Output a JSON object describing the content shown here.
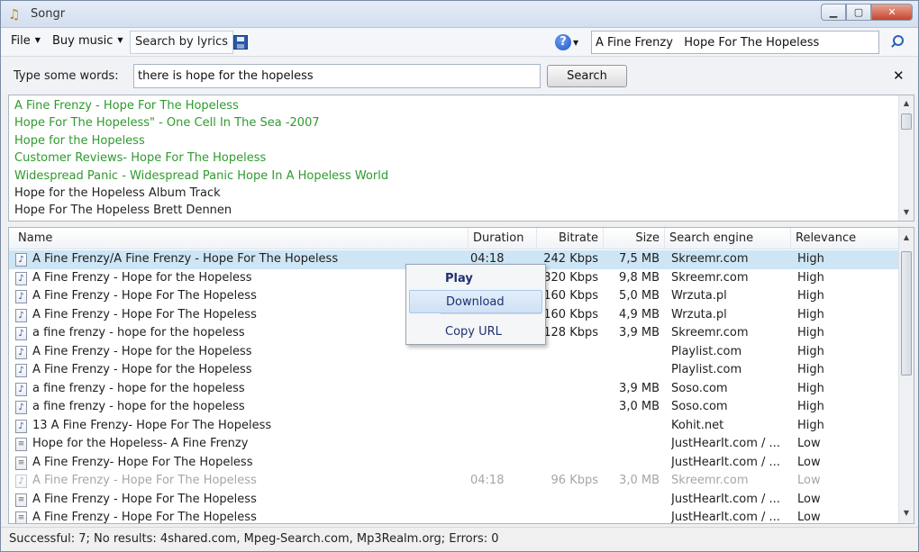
{
  "window": {
    "title": "Songr",
    "minimize": "▁",
    "maximize": "▢",
    "close": "✕"
  },
  "toolbar": {
    "file_menu": "File",
    "buy_music_menu": "Buy music",
    "search_lyrics_button": "Search by lyrics",
    "help_icon": "?",
    "search_value": "A Fine Frenzy   Hope For The Hopeless"
  },
  "lyrics_search": {
    "label": "Type some words:",
    "value": "there is hope for the hopeless",
    "button": "Search",
    "close": "✕"
  },
  "lyrics_results": [
    {
      "text": "A Fine Frenzy  - Hope For The Hopeless",
      "color": "green"
    },
    {
      "text": "Hope For The Hopeless\"  - One Cell In The Sea -2007",
      "color": "green"
    },
    {
      "text": "Hope for the Hopeless",
      "color": "green"
    },
    {
      "text": "Customer Reviews- Hope For The Hopeless",
      "color": "green"
    },
    {
      "text": "Widespread Panic  - Widespread Panic Hope In A Hopeless World",
      "color": "green"
    },
    {
      "text": "Hope for the Hopeless    Album Track",
      "color": "dark"
    },
    {
      "text": "Hope For The Hopeless  Brett Dennen",
      "color": "dark"
    }
  ],
  "columns": {
    "name": "Name",
    "duration": "Duration",
    "bitrate": "Bitrate",
    "size": "Size",
    "engine": "Search engine",
    "relevance": "Relevance"
  },
  "rows": [
    {
      "icon": "audio",
      "name": "A Fine Frenzy/A Fine Frenzy - Hope For The Hopeless",
      "duration": "04:18",
      "bitrate": "242 Kbps",
      "size": "7,5 MB",
      "engine": "Skreemr.com",
      "relevance": "High",
      "selected": true
    },
    {
      "icon": "audio",
      "name": "A Fine Frenzy - Hope for the Hopeless",
      "duration": "",
      "bitrate": "320 Kbps",
      "size": "9,8 MB",
      "engine": "Skreemr.com",
      "relevance": "High"
    },
    {
      "icon": "audio",
      "name": "A Fine Frenzy - Hope For The Hopeless",
      "duration": "",
      "bitrate": "160 Kbps",
      "size": "5,0 MB",
      "engine": "Wrzuta.pl",
      "relevance": "High"
    },
    {
      "icon": "audio",
      "name": "A Fine Frenzy - Hope For The Hopeless",
      "duration": "",
      "bitrate": "160 Kbps",
      "size": "4,9 MB",
      "engine": "Wrzuta.pl",
      "relevance": "High"
    },
    {
      "icon": "audio",
      "name": "a fine frenzy  -  hope for the hopeless",
      "duration": "",
      "bitrate": "128 Kbps",
      "size": "3,9 MB",
      "engine": "Skreemr.com",
      "relevance": "High"
    },
    {
      "icon": "audio",
      "name": "A Fine Frenzy - Hope for the Hopeless",
      "duration": "",
      "bitrate": "",
      "size": "",
      "engine": "Playlist.com",
      "relevance": "High"
    },
    {
      "icon": "audio",
      "name": "A Fine Frenzy - Hope for the Hopeless",
      "duration": "",
      "bitrate": "",
      "size": "",
      "engine": "Playlist.com",
      "relevance": "High"
    },
    {
      "icon": "audio",
      "name": "a fine frenzy - hope for the hopeless",
      "duration": "",
      "bitrate": "",
      "size": "3,9 MB",
      "engine": "Soso.com",
      "relevance": "High"
    },
    {
      "icon": "audio",
      "name": "a fine frenzy - hope for the hopeless",
      "duration": "",
      "bitrate": "",
      "size": "3,0 MB",
      "engine": "Soso.com",
      "relevance": "High"
    },
    {
      "icon": "audio",
      "name": "13 A Fine Frenzy- Hope For The Hopeless",
      "duration": "",
      "bitrate": "",
      "size": "",
      "engine": "Kohit.net",
      "relevance": "High"
    },
    {
      "icon": "doc",
      "name": "Hope for the Hopeless- A Fine Frenzy",
      "duration": "",
      "bitrate": "",
      "size": "",
      "engine": "JustHearIt.com / ...",
      "relevance": "Low"
    },
    {
      "icon": "doc",
      "name": "A Fine Frenzy- Hope For The Hopeless",
      "duration": "",
      "bitrate": "",
      "size": "",
      "engine": "JustHearIt.com / ...",
      "relevance": "Low"
    },
    {
      "icon": "audio",
      "name": "A Fine Frenzy - Hope For The Hopeless",
      "duration": "04:18",
      "bitrate": "96 Kbps",
      "size": "3,0 MB",
      "engine": "Skreemr.com",
      "relevance": "Low",
      "muted": true
    },
    {
      "icon": "doc",
      "name": "A Fine Frenzy - Hope For The Hopeless",
      "duration": "",
      "bitrate": "",
      "size": "",
      "engine": "JustHearIt.com / ...",
      "relevance": "Low"
    },
    {
      "icon": "doc",
      "name": "A Fine Frenzy - Hope For The Hopeless",
      "duration": "",
      "bitrate": "",
      "size": "",
      "engine": "JustHearIt.com / ...",
      "relevance": "Low"
    }
  ],
  "context_menu": {
    "play": "Play",
    "download": "Download",
    "copy_url": "Copy URL"
  },
  "status": "Successful: 7; No results: 4shared.com, Mpeg-Search.com, Mp3Realm.org; Errors: 0",
  "colors": {
    "lyric_green": "#2f9a2f",
    "selection": "#cde5f5",
    "muted_text": "#a6a6a6"
  }
}
